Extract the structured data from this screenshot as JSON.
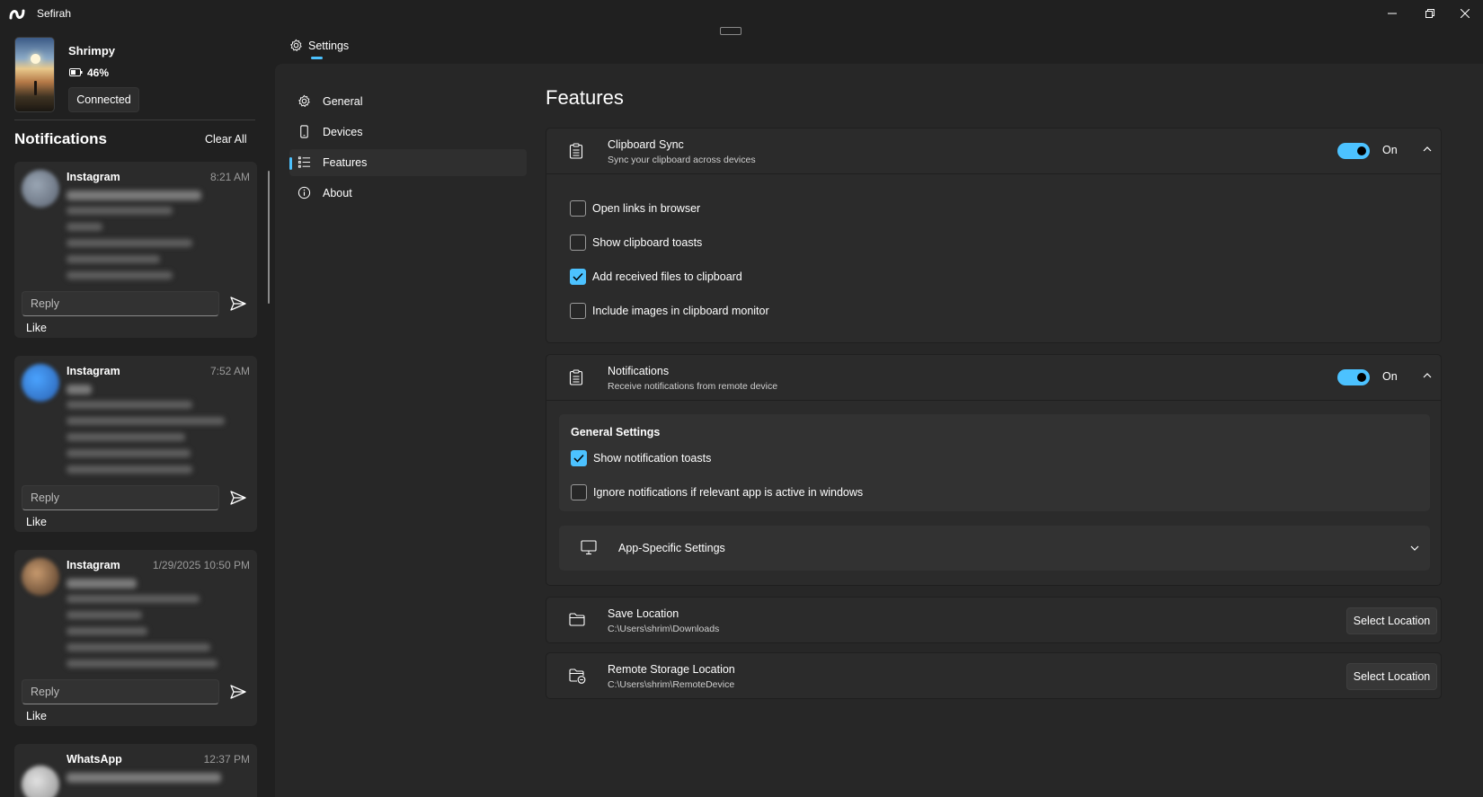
{
  "window": {
    "title": "Sefirah",
    "minimize_icon": "minimize-icon",
    "maximize_icon": "restore-icon",
    "close_icon": "close-icon"
  },
  "device": {
    "name": "Shrimpy",
    "battery": "46%",
    "status_button": "Connected"
  },
  "notifications_pane": {
    "heading": "Notifications",
    "clear_all": "Clear All",
    "reply_placeholder": "Reply",
    "like_label": "Like",
    "cards": [
      {
        "app": "Instagram",
        "time": "8:21 AM"
      },
      {
        "app": "Instagram",
        "time": "7:52 AM"
      },
      {
        "app": "Instagram",
        "time": "1/29/2025 10:50 PM"
      },
      {
        "app": "WhatsApp",
        "time": "12:37 PM"
      }
    ]
  },
  "settings_tab": {
    "label": "Settings",
    "icon": "gear-icon"
  },
  "nav": {
    "items": [
      {
        "label": "General",
        "icon": "gear-icon"
      },
      {
        "label": "Devices",
        "icon": "phone-icon"
      },
      {
        "label": "Features",
        "icon": "list-icon",
        "selected": true
      },
      {
        "label": "About",
        "icon": "info-icon"
      }
    ]
  },
  "page": {
    "title": "Features"
  },
  "clipboard_sync": {
    "title": "Clipboard Sync",
    "subtitle": "Sync your clipboard across devices",
    "toggle_label": "On",
    "enabled": true,
    "options": [
      {
        "label": "Open links in browser",
        "checked": false
      },
      {
        "label": "Show clipboard toasts",
        "checked": false
      },
      {
        "label": "Add received files to clipboard",
        "checked": true
      },
      {
        "label": "Include images in clipboard monitor",
        "checked": false
      }
    ]
  },
  "notifications_feature": {
    "title": "Notifications",
    "subtitle": "Receive notifications from remote device",
    "toggle_label": "On",
    "enabled": true,
    "general_settings": {
      "title": "General Settings",
      "options": [
        {
          "label": "Show notification toasts",
          "checked": true
        },
        {
          "label": "Ignore notifications if relevant app is active in windows",
          "checked": false
        }
      ]
    },
    "app_specific": {
      "title": "App-Specific Settings"
    }
  },
  "save_location": {
    "title": "Save Location",
    "path": "C:\\Users\\shrim\\Downloads",
    "button": "Select Location"
  },
  "remote_storage": {
    "title": "Remote Storage Location",
    "path": "C:\\Users\\shrim\\RemoteDevice",
    "button": "Select Location"
  },
  "colors": {
    "accent": "#4cc2ff",
    "background": "#202020",
    "panel": "#272727",
    "card": "#2b2b2b"
  }
}
